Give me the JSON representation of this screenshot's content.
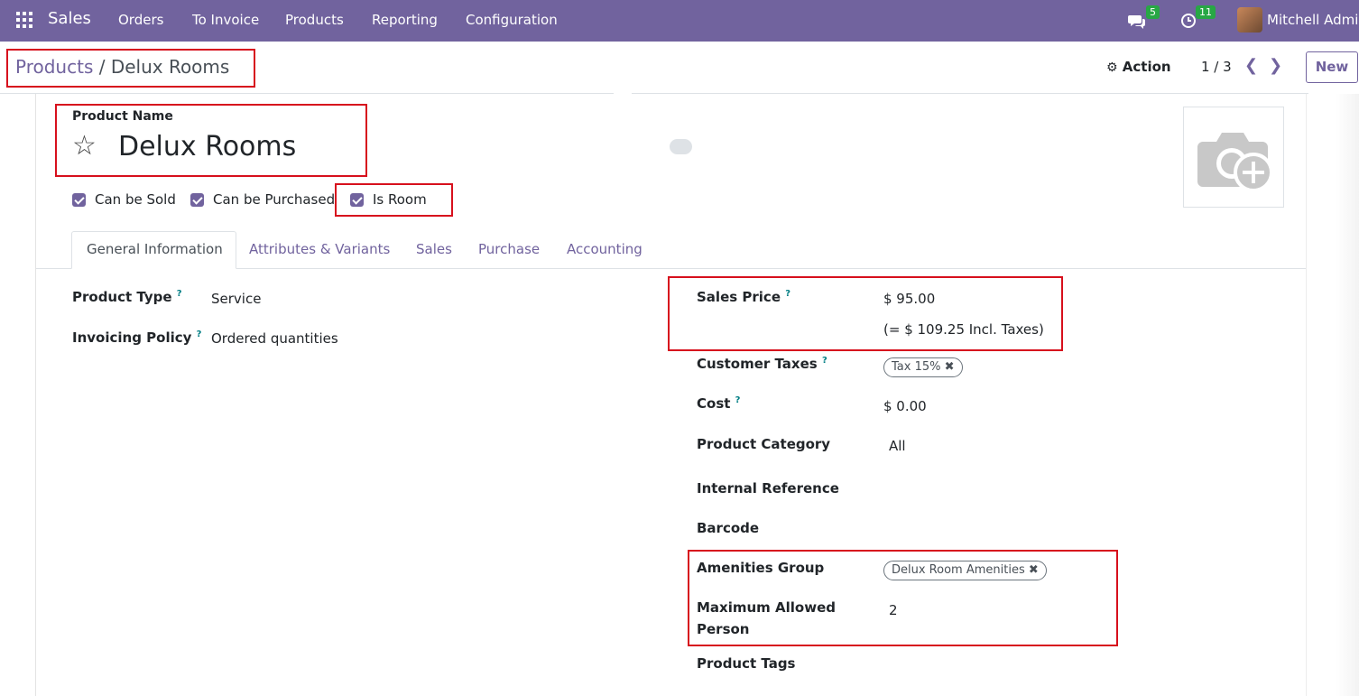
{
  "navbar": {
    "app_name": "Sales",
    "menu": [
      "Orders",
      "To Invoice",
      "Products",
      "Reporting",
      "Configuration"
    ],
    "messages_count": "5",
    "activities_count": "11",
    "user_name": "Mitchell Admin"
  },
  "breadcrumb": {
    "parent": "Products",
    "separator": " / ",
    "current": "Delux Rooms"
  },
  "control": {
    "action_label": "Action",
    "pager": "1 / 3",
    "new_label": "New"
  },
  "product": {
    "name_label": "Product Name",
    "name": "Delux Rooms",
    "checkboxes": [
      {
        "label": "Can be Sold",
        "checked": true
      },
      {
        "label": "Can be Purchased",
        "checked": true
      },
      {
        "label": "Is Room",
        "checked": true
      }
    ]
  },
  "tabs": [
    "General Information",
    "Attributes & Variants",
    "Sales",
    "Purchase",
    "Accounting"
  ],
  "left_fields": {
    "product_type_label": "Product Type",
    "product_type": "Service",
    "invoicing_policy_label": "Invoicing Policy",
    "invoicing_policy": "Ordered quantities"
  },
  "right_fields": {
    "sales_price_label": "Sales Price",
    "sales_price": "$ 95.00",
    "sales_price_incl": "(= $ 109.25 Incl. Taxes)",
    "customer_taxes_label": "Customer Taxes",
    "customer_tax_tag": "Tax 15%",
    "cost_label": "Cost",
    "cost": "$ 0.00",
    "category_label": "Product Category",
    "category": "All",
    "internal_ref_label": "Internal Reference",
    "barcode_label": "Barcode",
    "amenities_label": "Amenities Group",
    "amenities_tag": "Delux Room Amenities",
    "max_person_label_1": "Maximum Allowed",
    "max_person_label_2": "Person",
    "max_person": "2",
    "tags_label": "Product Tags"
  },
  "help_mark": "?",
  "colors": {
    "brand": "#71639e",
    "highlight": "#d7101d",
    "badge": "#28a745"
  }
}
